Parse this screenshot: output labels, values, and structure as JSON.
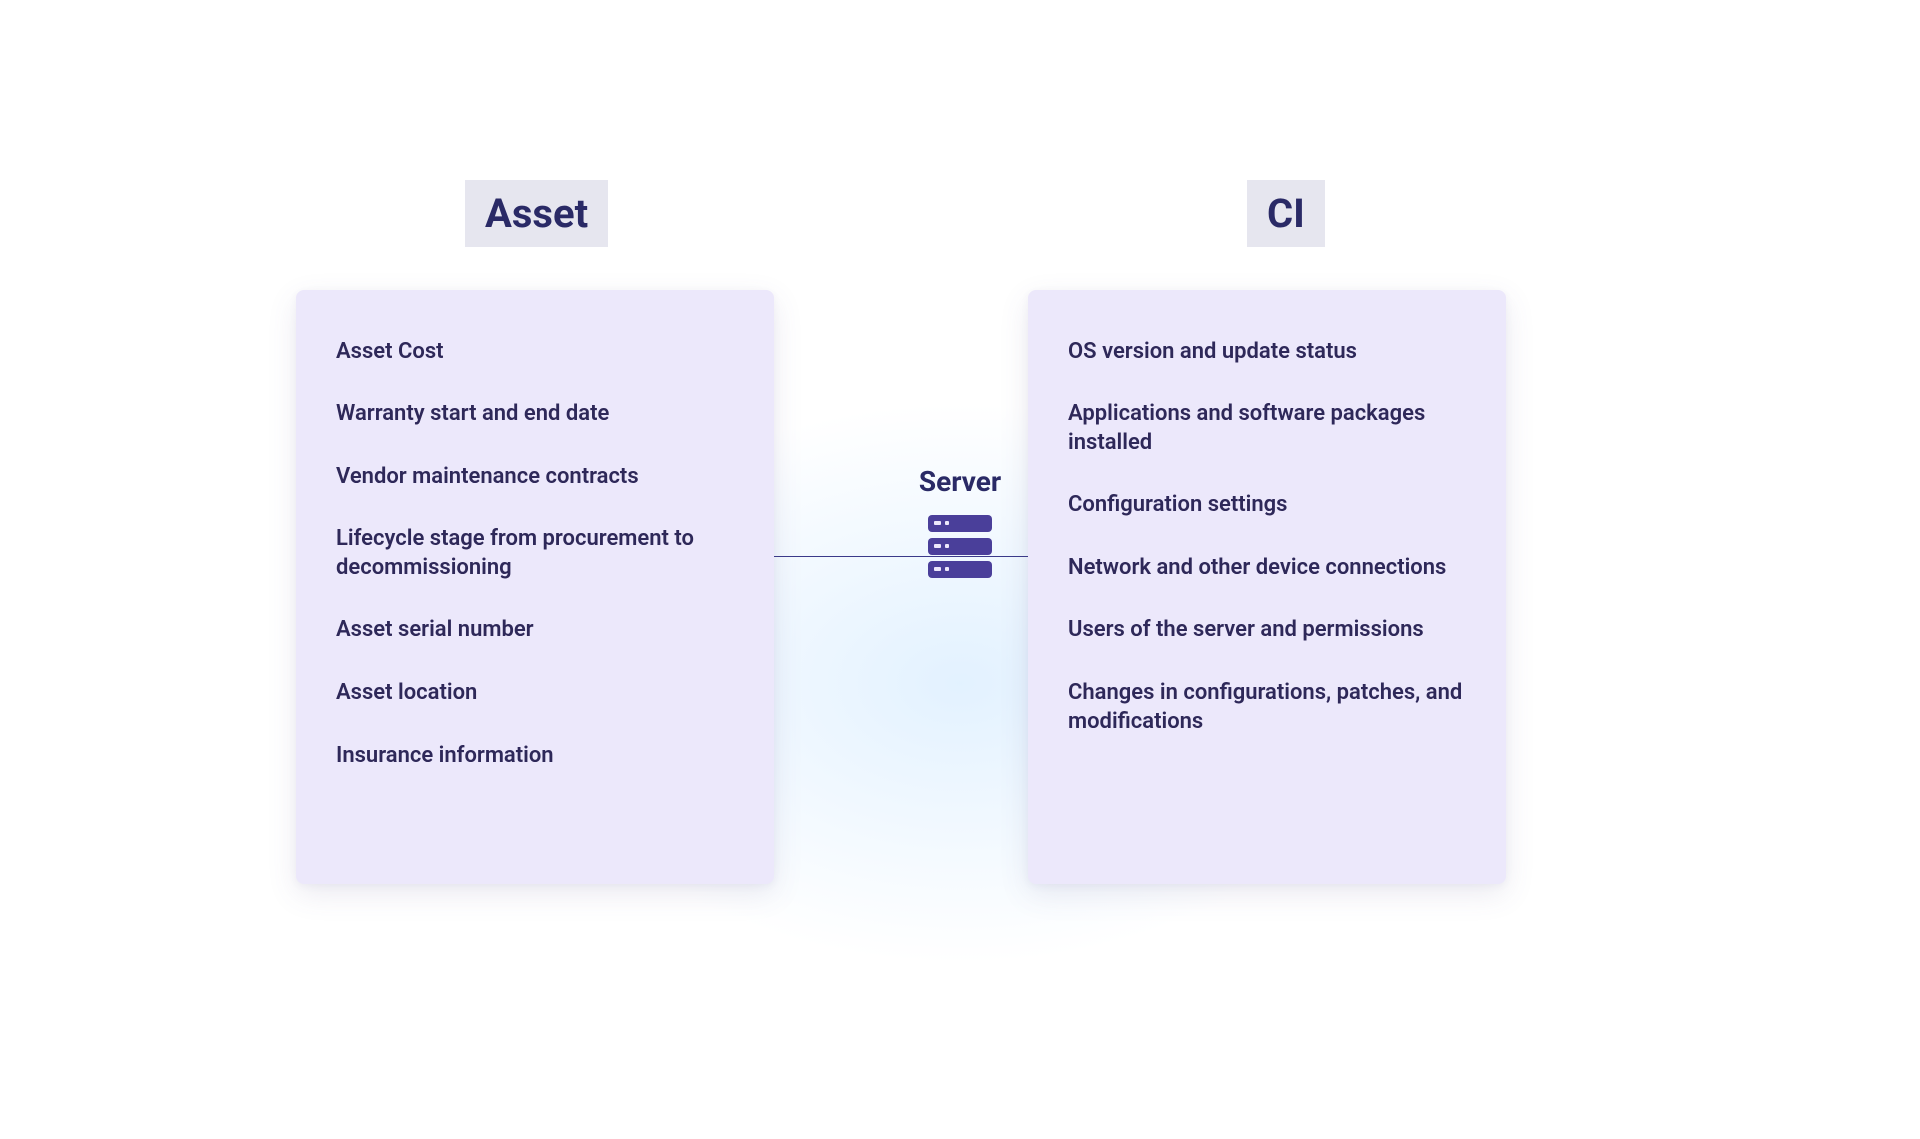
{
  "headings": {
    "asset": "Asset",
    "ci": "CI"
  },
  "center": {
    "label": "Server"
  },
  "asset_items": [
    "Asset Cost",
    "Warranty start and end date",
    "Vendor maintenance contracts",
    "Lifecycle stage from procurement to decommissioning",
    "Asset serial number",
    "Asset location",
    "Insurance information"
  ],
  "ci_items": [
    "OS version and update status",
    "Applications and software packages installed",
    "Configuration settings",
    "Network and other device connections",
    "Users of the server and permissions",
    "Changes in configurations, patches, and modifications"
  ]
}
